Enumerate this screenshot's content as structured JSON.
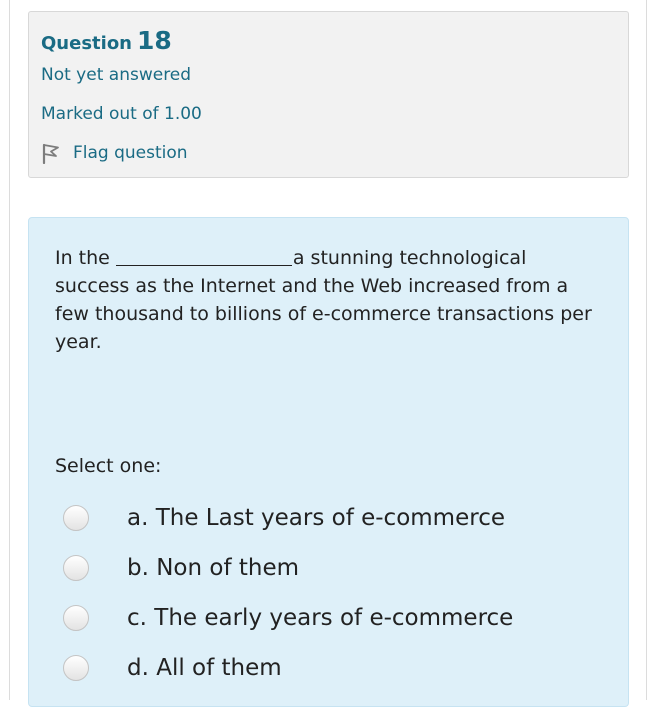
{
  "question": {
    "label": "Question",
    "number": "18",
    "state": "Not yet answered",
    "grade": "Marked out of 1.00",
    "flag_label": "Flag question",
    "icons": {
      "flag": "flag-icon"
    }
  },
  "body": {
    "text_before_blank": "In the",
    "text_after_blank": "a stunning technological success as the Internet and the Web increased from a few thousand to billions of e-commerce transactions per year.",
    "prompt": "Select one:",
    "options": [
      {
        "label": "a. The Last years of e-commerce",
        "selected": false
      },
      {
        "label": "b. Non of them",
        "selected": false
      },
      {
        "label": "c. The early years of e-commerce",
        "selected": false
      },
      {
        "label": "d. All of them",
        "selected": false
      }
    ]
  },
  "colors": {
    "accent": "#1a6b84",
    "info_bg": "#f2f2f2",
    "formulation_bg": "#def0f9"
  }
}
